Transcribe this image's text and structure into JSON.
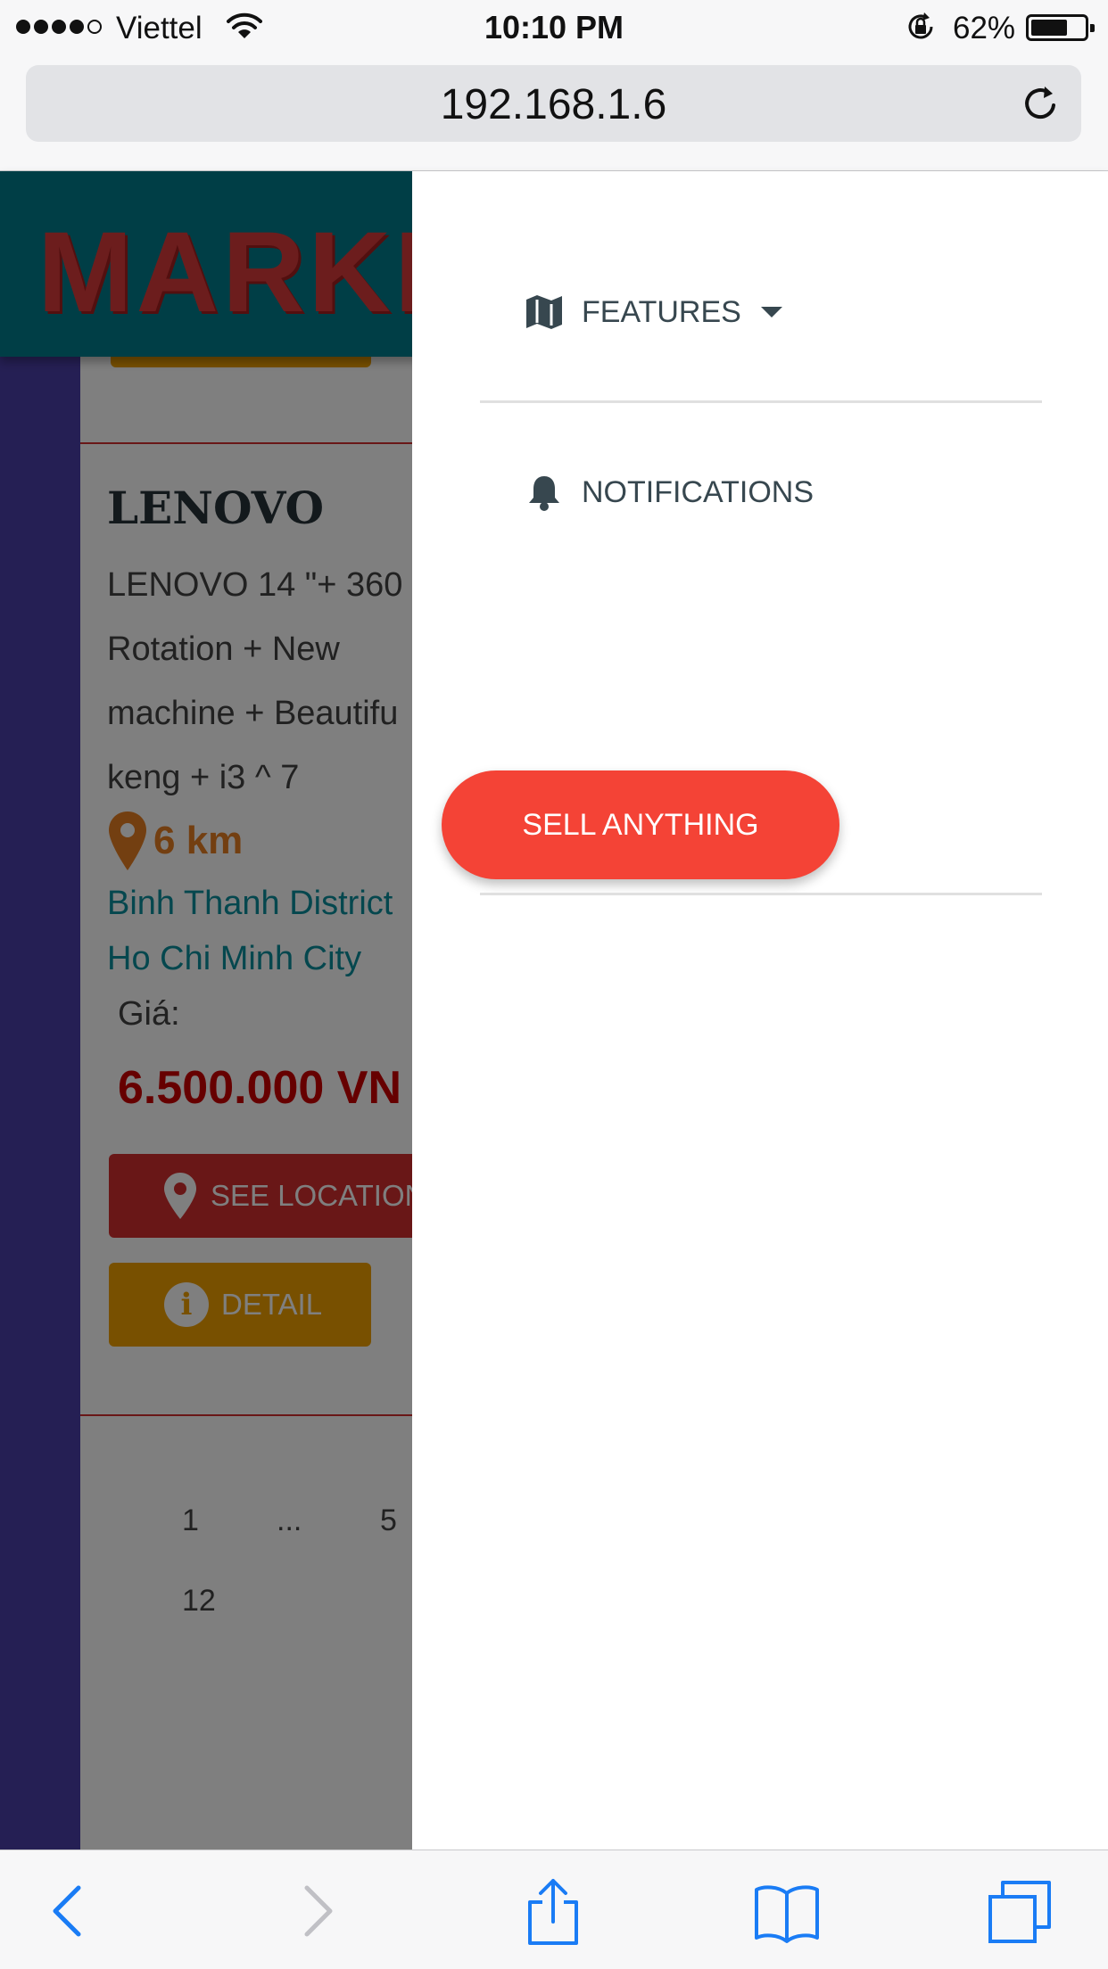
{
  "status_bar": {
    "carrier": "Viettel",
    "time": "10:10 PM",
    "battery_percent": "62%",
    "battery_level": 0.62
  },
  "browser": {
    "url": "192.168.1.6"
  },
  "page": {
    "brand": "MARKE",
    "product": {
      "title": "LENOVO",
      "description_lines": [
        "LENOVO 14 \"+ 360",
        "Rotation + New",
        "machine + Beautifu",
        "keng + i3 ^ 7"
      ],
      "distance": "6 km",
      "address_lines": [
        "Binh Thanh District",
        "Ho Chi Minh City"
      ],
      "price_label": "Giá:",
      "price": "6.500.000 VN",
      "see_location_label": "SEE LOCATION",
      "detail_label": "DETAIL"
    },
    "pagination": {
      "items": [
        "1",
        "...",
        "5",
        "12"
      ]
    }
  },
  "drawer": {
    "features_label": "FEATURES",
    "notifications_label": "NOTIFICATIONS",
    "sell_button_label": "SELL ANYTHING"
  },
  "colors": {
    "accent_red": "#f44336",
    "header_teal": "#007d8c",
    "brand_red": "#d83b3b",
    "ios_blue": "#1a7cf5"
  }
}
